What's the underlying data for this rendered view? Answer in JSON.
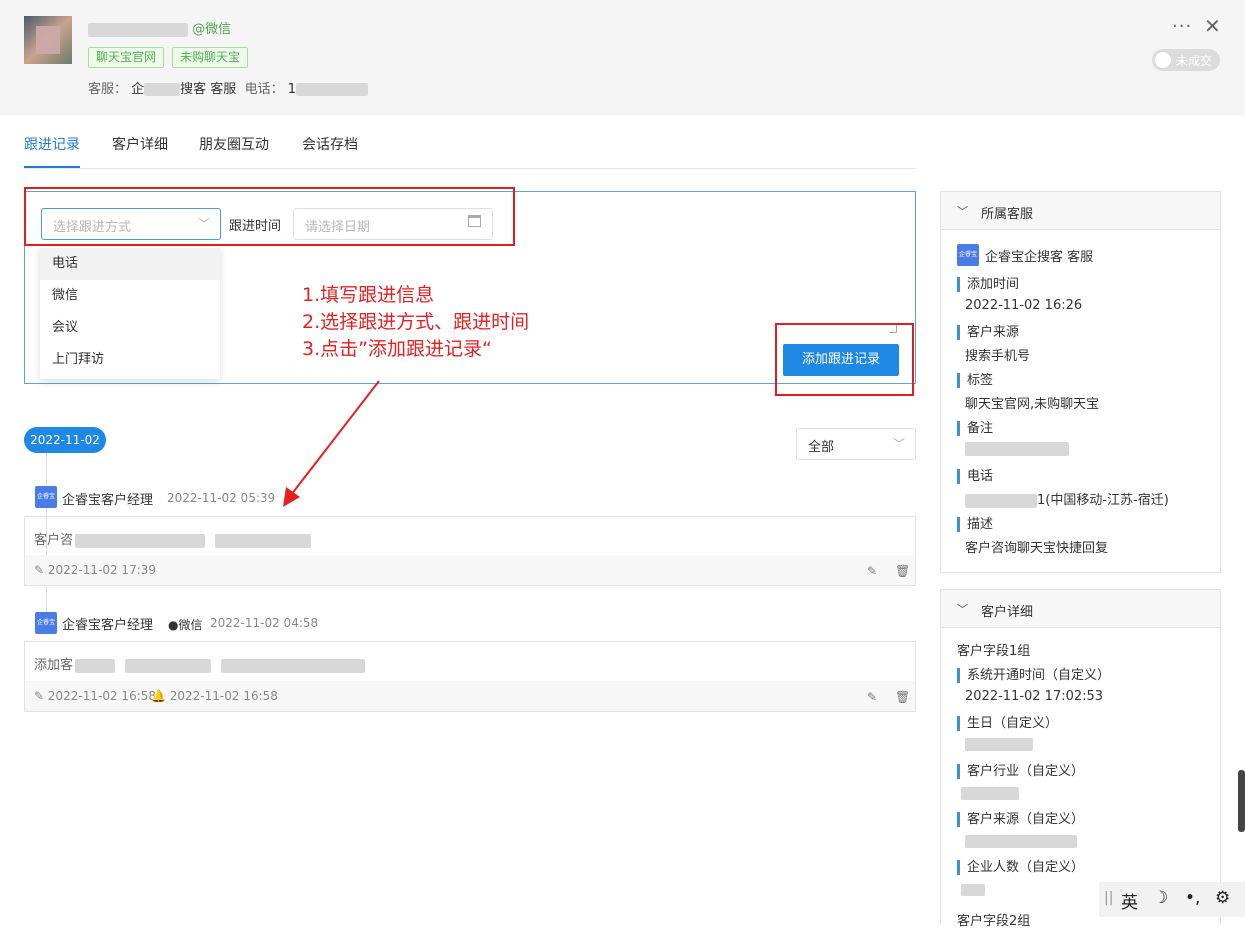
{
  "header": {
    "source": "@微信",
    "tags": [
      "聊天宝官网",
      "未购聊天宝"
    ],
    "agent_label": "客服：",
    "agent_value": "企",
    "agent_value_suffix": "搜客 客服",
    "phone_label": "电话：",
    "phone_value": "1",
    "status_toggle": "未成交"
  },
  "tabs": [
    "跟进记录",
    "客户详细",
    "朋友圈互动",
    "会话存档"
  ],
  "form": {
    "method_placeholder": "选择跟进方式",
    "time_label": "跟进时间",
    "date_placeholder": "请选择日期",
    "options": [
      "电话",
      "微信",
      "会议",
      "上门拜访"
    ],
    "add_button": "添加跟进记录"
  },
  "annotation": [
    "1.填写跟进信息",
    "2.选择跟进方式、跟进时间",
    "3.点击”添加跟进记录“"
  ],
  "timeline": {
    "date": "2022-11-02",
    "filter": "全部",
    "records": [
      {
        "avatar": "企睿宝",
        "author": "企睿宝客户经理",
        "channel": "",
        "time": "2022-11-02 05:39",
        "text": "客户咨",
        "edited": "2022-11-02 17:39",
        "remind": ""
      },
      {
        "avatar": "企睿宝",
        "author": "企睿宝客户经理",
        "channel": "●微信",
        "time": "2022-11-02 04:58",
        "text": "添加客",
        "edited": "2022-11-02 16:58",
        "remind": "2022-11-02 16:58"
      }
    ]
  },
  "side_agent": {
    "title": "所属客服",
    "avatar": "企睿宝",
    "name": "企睿宝企搜客 客服",
    "fields": [
      {
        "label": "添加时间",
        "value": "2022-11-02 16:26"
      },
      {
        "label": "客户来源",
        "value": "搜索手机号"
      },
      {
        "label": "标签",
        "value": "聊天宝官网,未购聊天宝"
      },
      {
        "label": "备注",
        "value": ""
      },
      {
        "label": "电话",
        "value": "1(中国移动-江苏-宿迁)"
      },
      {
        "label": "描述",
        "value": "客户咨询聊天宝快捷回复"
      }
    ]
  },
  "side_detail": {
    "title": "客户详细",
    "group1": "客户字段1组",
    "fields": [
      {
        "label": "系统开通时间（自定义）",
        "value": "2022-11-02 17:02:53"
      },
      {
        "label": "生日（自定义）",
        "value": ""
      },
      {
        "label": "客户行业（自定义）",
        "value": ""
      },
      {
        "label": "客户来源（自定义）",
        "value": ""
      },
      {
        "label": "企业人数（自定义）",
        "value": ""
      }
    ],
    "group2": "客户字段2组"
  },
  "ime": {
    "lang": "英",
    "moon": "☽",
    "punct": "•,",
    "settings": "⚙"
  }
}
